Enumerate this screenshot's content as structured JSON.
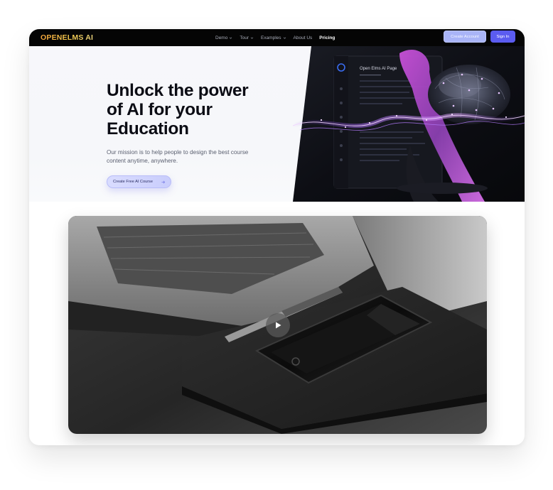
{
  "brand": {
    "logo_text": "OPENELMS AI"
  },
  "nav": {
    "links": [
      {
        "label": "Demo",
        "has_dropdown": true
      },
      {
        "label": "Tour",
        "has_dropdown": true
      },
      {
        "label": "Examples",
        "has_dropdown": true
      },
      {
        "label": "About Us",
        "has_dropdown": false
      },
      {
        "label": "Pricing",
        "has_dropdown": false,
        "active": true
      }
    ],
    "create_account_label": "Create Account",
    "sign_in_label": "Sign In"
  },
  "hero": {
    "title_line1": "Unlock the power",
    "title_line2": "of AI for your",
    "title_line3": "Education",
    "subtitle_line1": "Our mission is to help people to design the best course",
    "subtitle_line2": "content anytime, anywhere.",
    "cta_label": "Create Free AI Course",
    "illustration_panel_title": "Open Elms AI Page"
  },
  "video": {
    "play_icon": "play-icon",
    "thumbnail": "laptop-phone-pen-notebook"
  },
  "colors": {
    "nav_bg": "#050505",
    "accent": "#5b5cf0",
    "accent_light": "#a9b4f7",
    "logo_gradient": "#f2c94c",
    "hero_title": "#0b0c14"
  }
}
